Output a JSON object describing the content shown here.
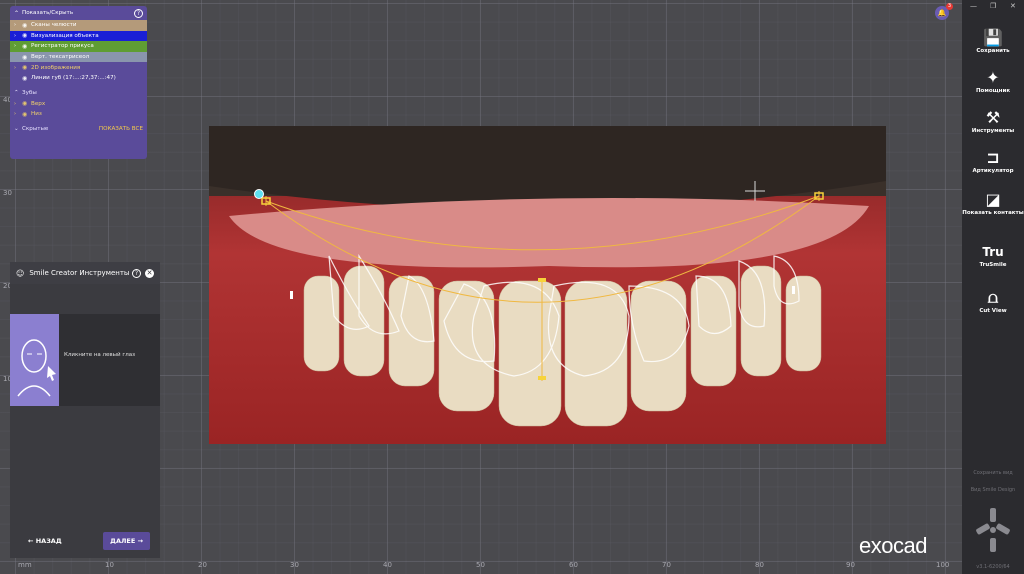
{
  "show_panel": {
    "title": "Показать/Скрыть",
    "items": [
      {
        "label": "Сканы челюсти"
      },
      {
        "label": "Визуализация объекта"
      },
      {
        "label": "Регистратор прикуса"
      },
      {
        "label": "Верт. тексатрисеол"
      },
      {
        "label": "2D изображения"
      },
      {
        "label": "Линии губ (17:...:27,37:...:47)"
      }
    ],
    "teeth_section": "Зубы",
    "teeth_items": [
      {
        "label": "Верх"
      },
      {
        "label": "Низ"
      }
    ],
    "hidden_label": "Скрытые",
    "show_all": "ПОКАЗАТЬ ВСЕ"
  },
  "smile_creator": {
    "title": "Smile Creator Инструменты",
    "instruction": "Кликните на левый глаз",
    "back_label": "НАЗАД",
    "next_label": "ДАЛЕЕ"
  },
  "axis": {
    "x_labels": [
      "mm",
      "10",
      "20",
      "30",
      "40",
      "50",
      "60",
      "70",
      "80",
      "90",
      "100"
    ],
    "y_labels": [
      "40",
      "30",
      "20",
      "10"
    ]
  },
  "toolbar": {
    "items": [
      {
        "label": "Сохранить",
        "icon": "save-icon"
      },
      {
        "label": "Помощник",
        "icon": "wizard-icon"
      },
      {
        "label": "Инструменты",
        "icon": "tools-icon"
      },
      {
        "label": "Артикулятор",
        "icon": "articulator-icon"
      },
      {
        "label": "Показать контакты",
        "icon": "contacts-icon"
      },
      {
        "label": "TruSmile",
        "icon": "trusmile-icon"
      },
      {
        "label": "Cut View",
        "icon": "cut-view-icon"
      }
    ],
    "save_view": "Сохранить вид",
    "view_smile": "Вид Smile Design",
    "version": "v3.1-6200/64"
  },
  "notification_count": "3",
  "brand": "exocad",
  "colors": {
    "panel_purple": "#5a4b9a",
    "accent_yellow": "#f3d36a",
    "row_brown": "#b49a7a",
    "row_blue": "#1a1fd6",
    "row_green": "#5f9d33"
  }
}
